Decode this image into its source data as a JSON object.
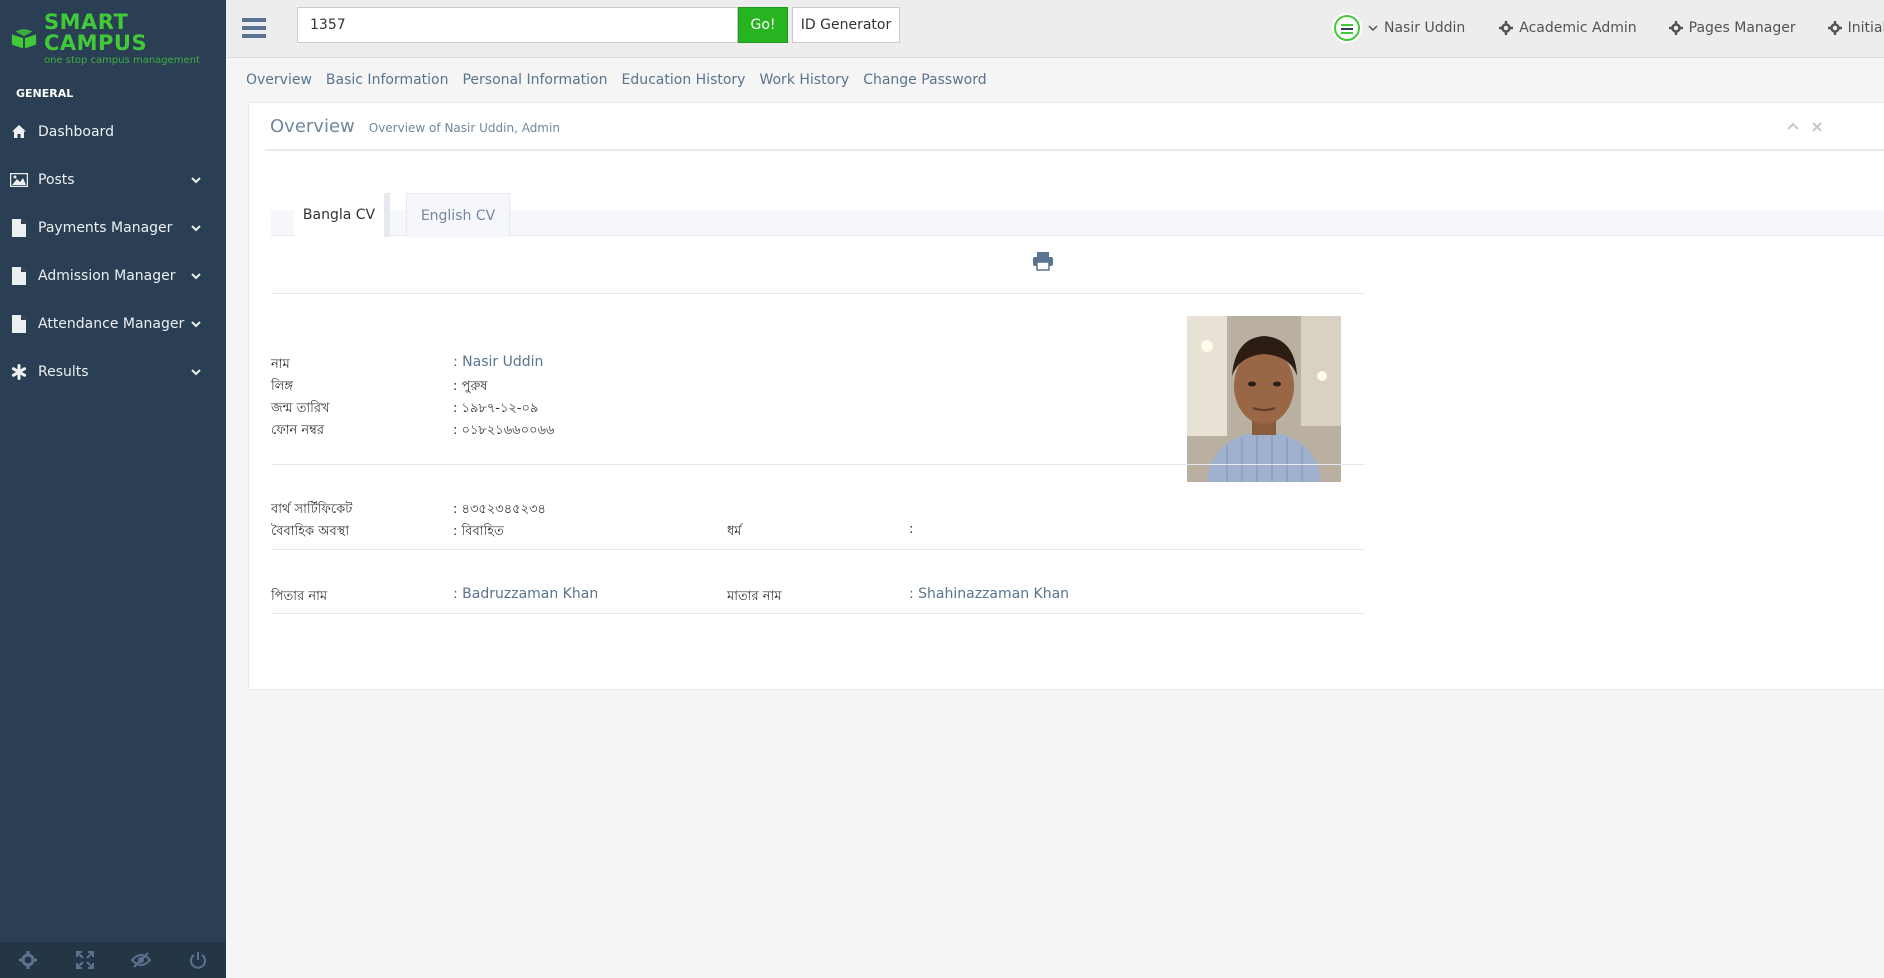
{
  "brand": {
    "title": "SMART CAMPUS",
    "subtitle": "one stop campus management",
    "color": "#41c93a"
  },
  "sidebar": {
    "section": "GENERAL",
    "items": [
      {
        "label": "Dashboard",
        "icon": "home-icon",
        "has_children": false
      },
      {
        "label": "Posts",
        "icon": "image-icon",
        "has_children": true
      },
      {
        "label": "Payments Manager",
        "icon": "file-icon",
        "has_children": true
      },
      {
        "label": "Admission Manager",
        "icon": "file-icon",
        "has_children": true
      },
      {
        "label": "Attendance Manager",
        "icon": "file-icon",
        "has_children": true
      },
      {
        "label": "Results",
        "icon": "asterisk-icon",
        "has_children": true
      }
    ],
    "footer_icons": [
      "settings-icon",
      "fullscreen-icon",
      "eye-slash-icon",
      "power-icon"
    ]
  },
  "topbar": {
    "search_value": "1357",
    "go_label": "Go!",
    "id_generator_label": "ID Generator",
    "user_name": "Nasir Uddin",
    "links": [
      {
        "label": "Academic Admin",
        "icon": "gear-icon"
      },
      {
        "label": "Pages Manager",
        "icon": "gear-icon"
      },
      {
        "label": "Initial Sett",
        "icon": "gear-icon"
      }
    ]
  },
  "subnav": [
    "Overview",
    "Basic Information",
    "Personal Information",
    "Education History",
    "Work History",
    "Change Password"
  ],
  "panel": {
    "title": "Overview",
    "subtitle": "Overview of Nasir Uddin, Admin",
    "tabs": [
      "Bangla CV",
      "English CV"
    ],
    "active_tab": "Bangla CV"
  },
  "profile": {
    "name_label": "নাম",
    "name_value": ": Nasir Uddin",
    "gender_label": "লিঙ্গ",
    "gender_value": ": পুরুষ",
    "dob_label": "জন্ম তারিখ",
    "dob_value": ": ১৯৮৭-১২-০৯",
    "phone_label": "ফোন নম্বর",
    "phone_value": ": ০১৮২১৬৬০০৬৬",
    "birth_cert_label": "বার্থ সার্টিফিকেট",
    "birth_cert_value": ": ৪৩৫২৩৪৫২৩৪",
    "marital_label": "বৈবাহিক অবস্থা",
    "marital_value": ": বিবাহিত",
    "religion_label": "ধর্ম",
    "religion_value": ":",
    "father_label": "পিতার নাম",
    "father_value": ": Badruzzaman Khan",
    "mother_label": "মাতার নাম",
    "mother_value": ": Shahinazzaman Khan"
  }
}
